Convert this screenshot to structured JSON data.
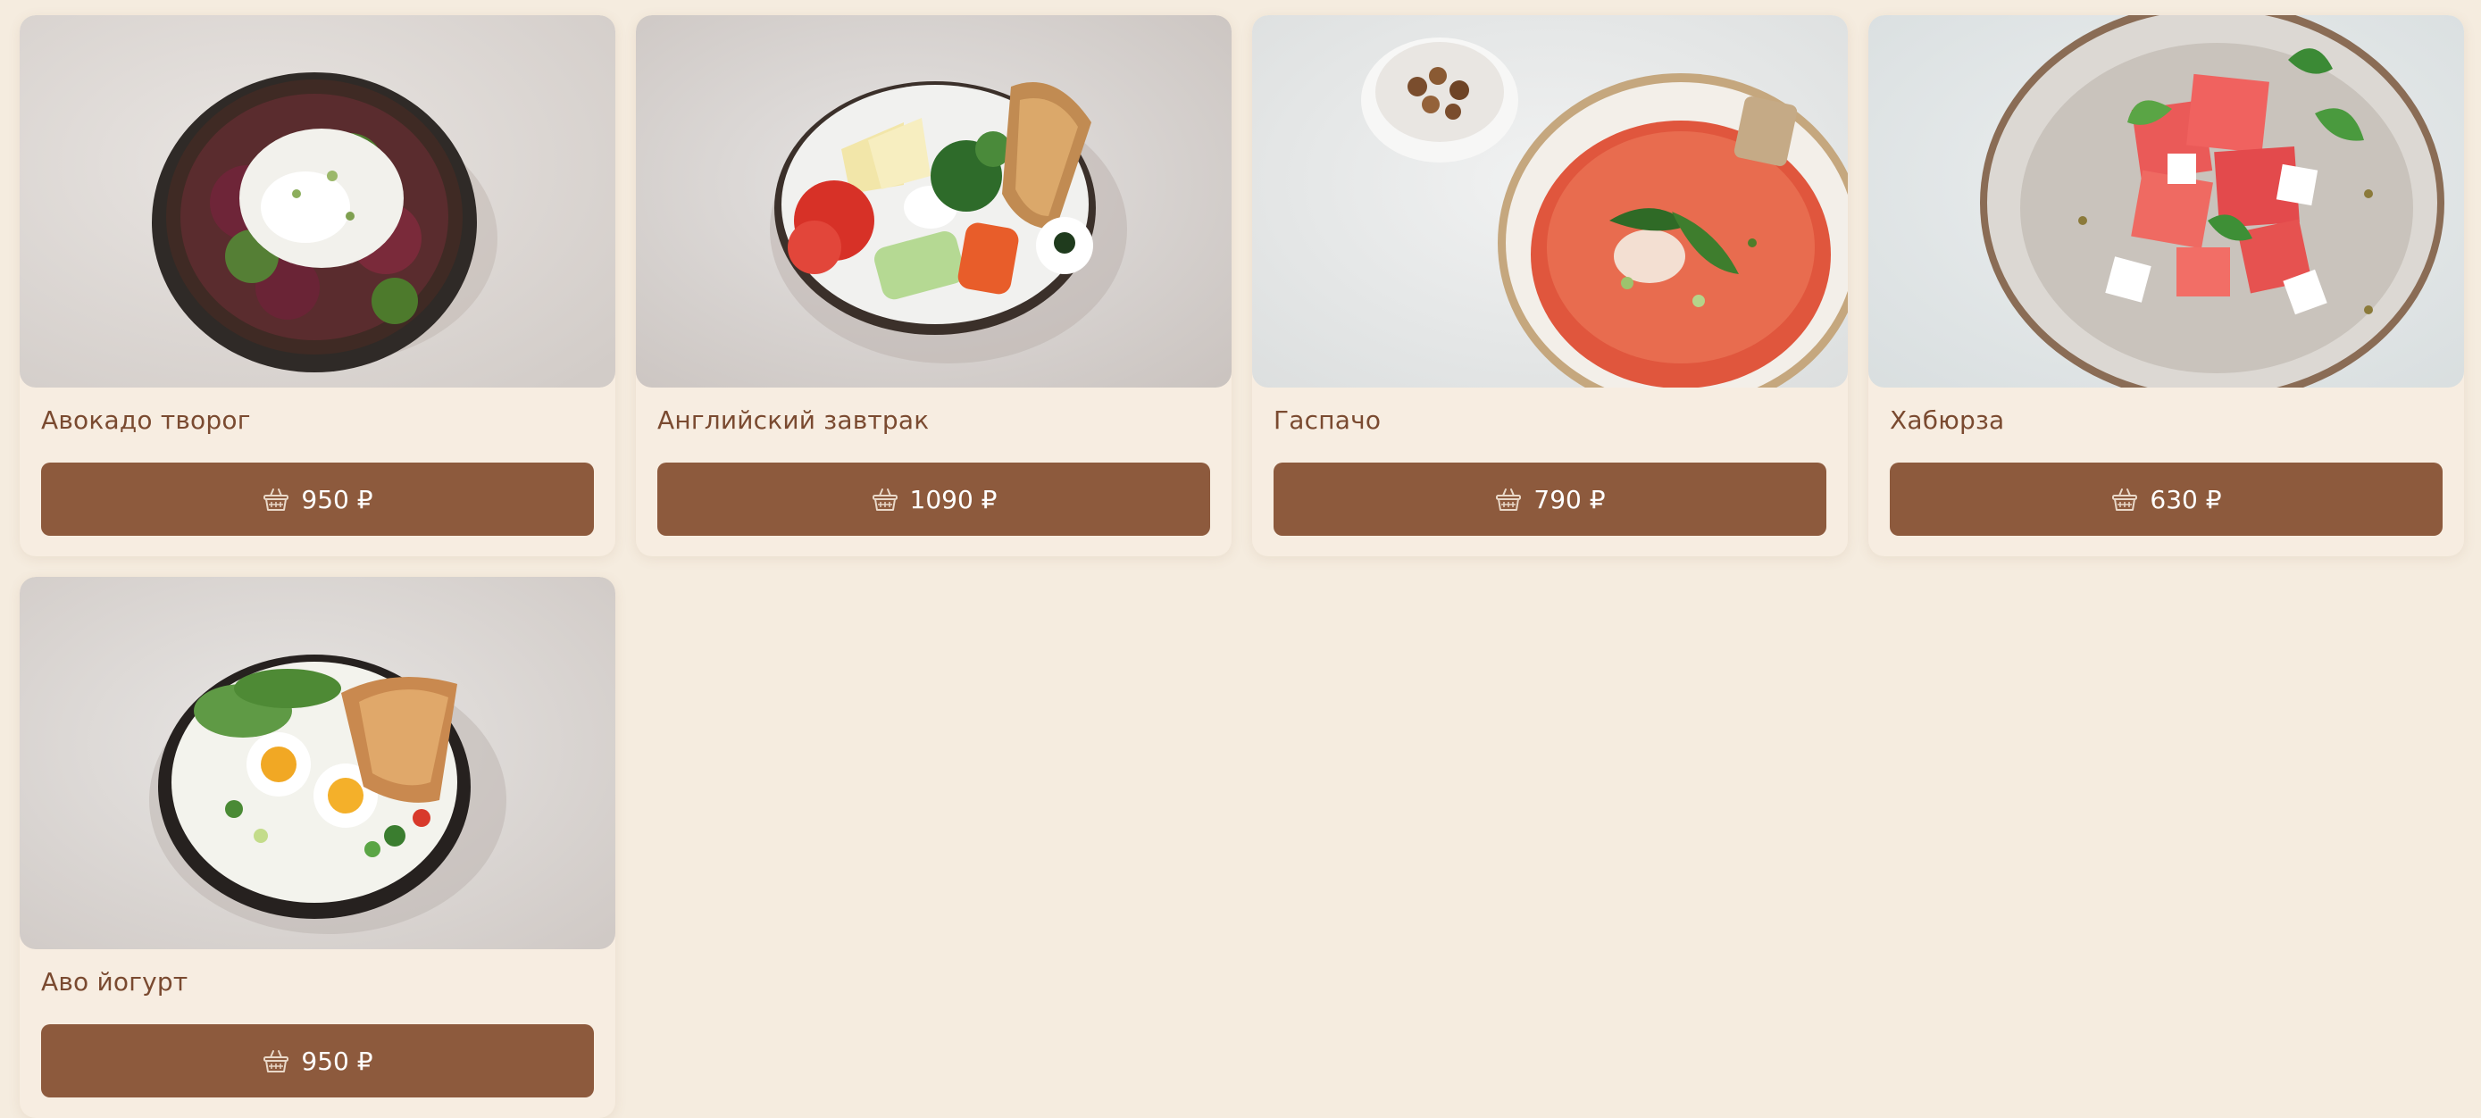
{
  "icons": {
    "cart": "basket-icon"
  },
  "colors": {
    "background": "#f5ecdf",
    "button": "#8d5a3d",
    "title": "#7a4a30"
  },
  "products": [
    {
      "name": "Авокадо творог",
      "price": "950 ₽",
      "photo": "salad-plate-image"
    },
    {
      "name": "Английский завтрак",
      "price": "1090 ₽",
      "photo": "breakfast-plate-image"
    },
    {
      "name": "Гаспачо",
      "price": "790 ₽",
      "photo": "soup-bowl-image"
    },
    {
      "name": "Хабюрза",
      "price": "630 ₽",
      "photo": "watermelon-salad-image"
    },
    {
      "name": "Аво йогурт",
      "price": "950 ₽",
      "photo": "egg-bowl-image"
    }
  ]
}
